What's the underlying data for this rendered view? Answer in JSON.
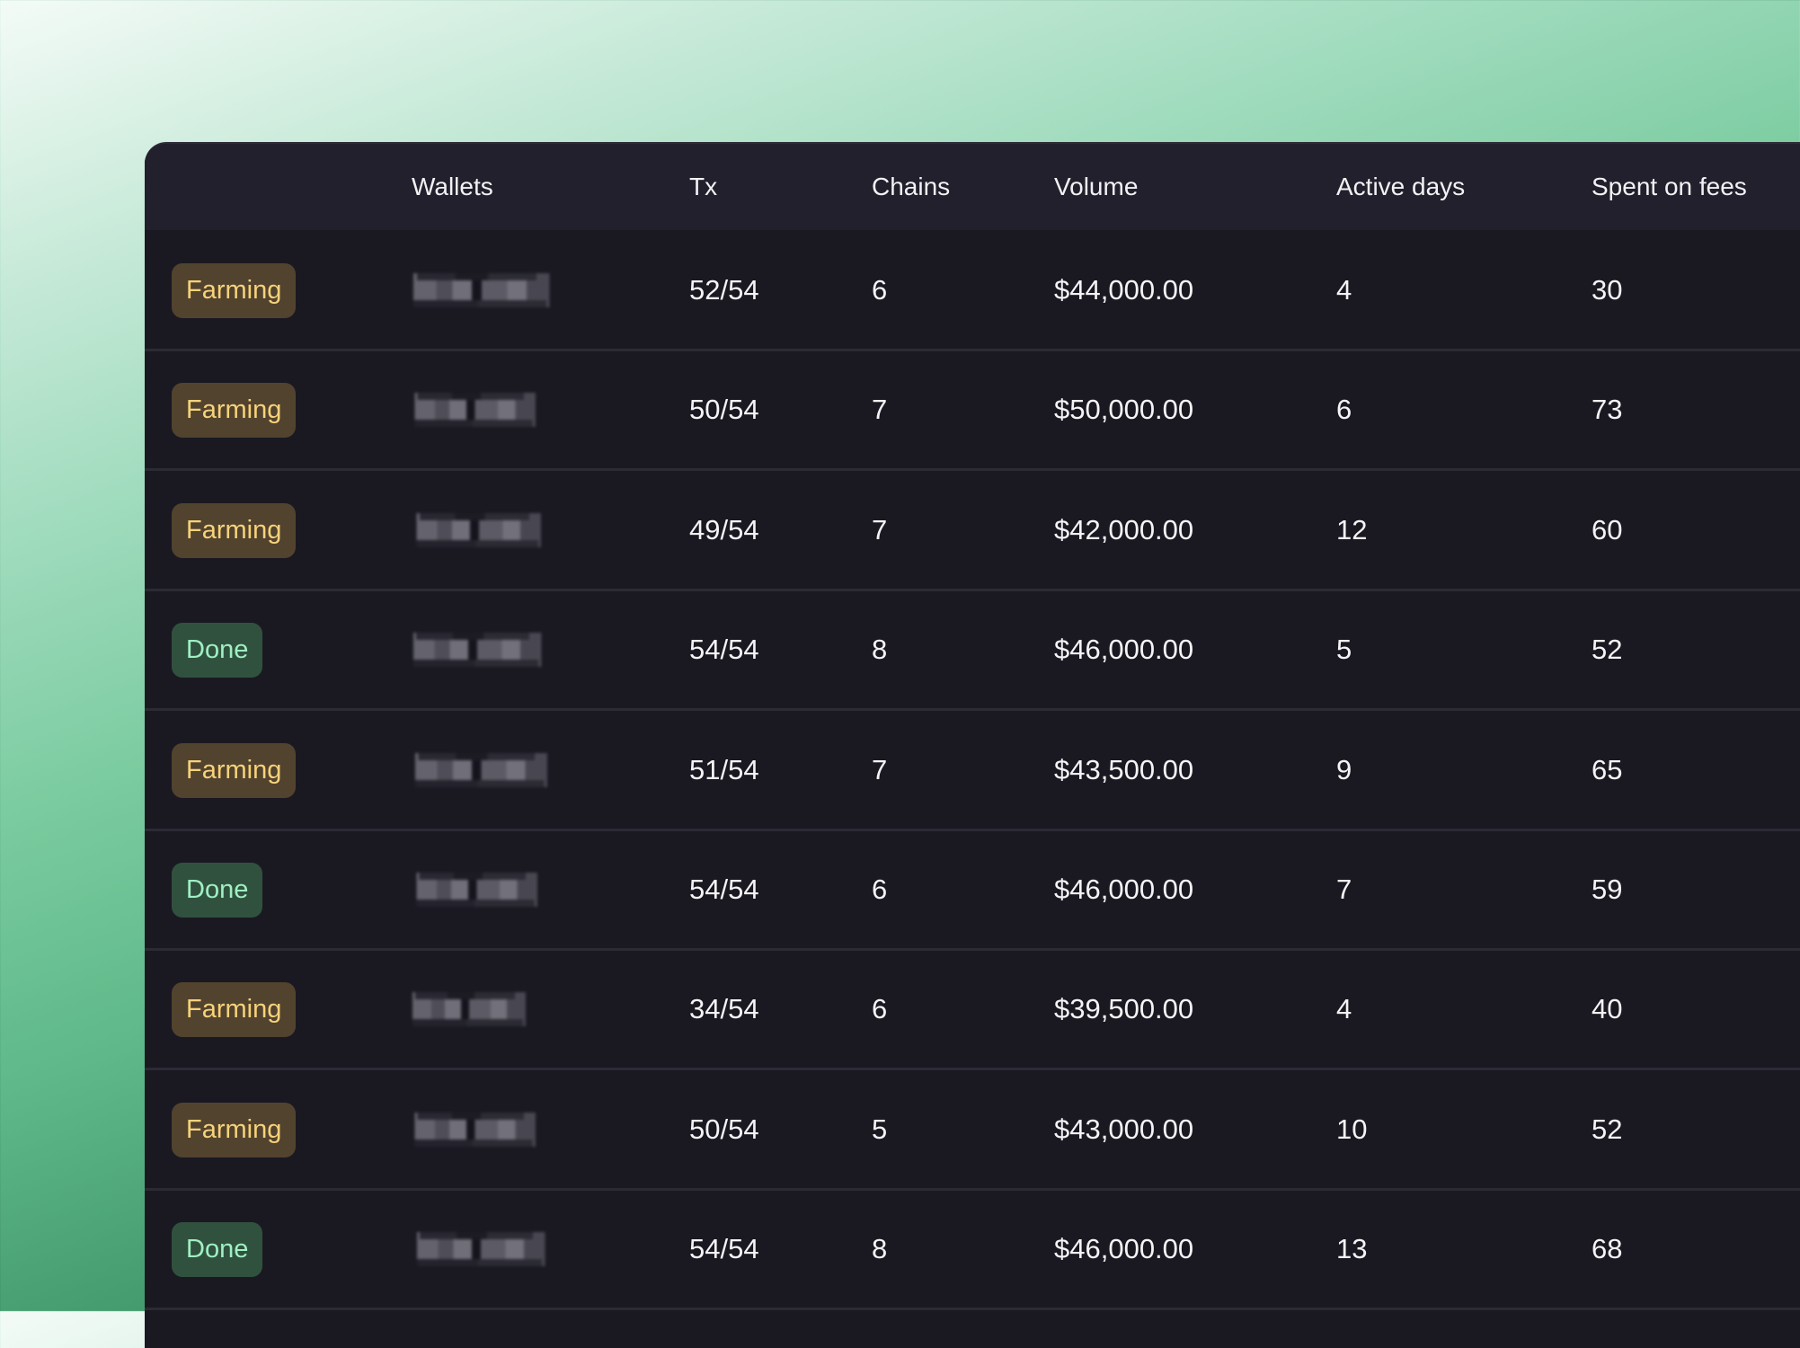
{
  "table": {
    "columns": [
      "",
      "Wallets",
      "Tx",
      "Chains",
      "Volume",
      "Active days",
      "Spent on fees"
    ],
    "status_colors": {
      "Farming": {
        "bg": "#52432f",
        "fg": "#f6d27a"
      },
      "Done": {
        "bg": "#31513f",
        "fg": "#9ff0c3"
      }
    },
    "rows": [
      {
        "status": "Farming",
        "wallet": "[redacted]",
        "tx": "52/54",
        "chains": "6",
        "volume": "$44,000.00",
        "active_days": "4",
        "fees": "30"
      },
      {
        "status": "Farming",
        "wallet": "[redacted]",
        "tx": "50/54",
        "chains": "7",
        "volume": "$50,000.00",
        "active_days": "6",
        "fees": "73"
      },
      {
        "status": "Farming",
        "wallet": "[redacted]",
        "tx": "49/54",
        "chains": "7",
        "volume": "$42,000.00",
        "active_days": "12",
        "fees": "60"
      },
      {
        "status": "Done",
        "wallet": "[redacted]",
        "tx": "54/54",
        "chains": "8",
        "volume": "$46,000.00",
        "active_days": "5",
        "fees": "52"
      },
      {
        "status": "Farming",
        "wallet": "[redacted]",
        "tx": "51/54",
        "chains": "7",
        "volume": "$43,500.00",
        "active_days": "9",
        "fees": "65"
      },
      {
        "status": "Done",
        "wallet": "[redacted]",
        "tx": "54/54",
        "chains": "6",
        "volume": "$46,000.00",
        "active_days": "7",
        "fees": "59"
      },
      {
        "status": "Farming",
        "wallet": "[redacted]",
        "tx": "34/54",
        "chains": "6",
        "volume": "$39,500.00",
        "active_days": "4",
        "fees": "40"
      },
      {
        "status": "Farming",
        "wallet": "[redacted]",
        "tx": "50/54",
        "chains": "5",
        "volume": "$43,000.00",
        "active_days": "10",
        "fees": "52"
      },
      {
        "status": "Done",
        "wallet": "[redacted]",
        "tx": "54/54",
        "chains": "8",
        "volume": "$46,000.00",
        "active_days": "13",
        "fees": "68"
      }
    ]
  }
}
